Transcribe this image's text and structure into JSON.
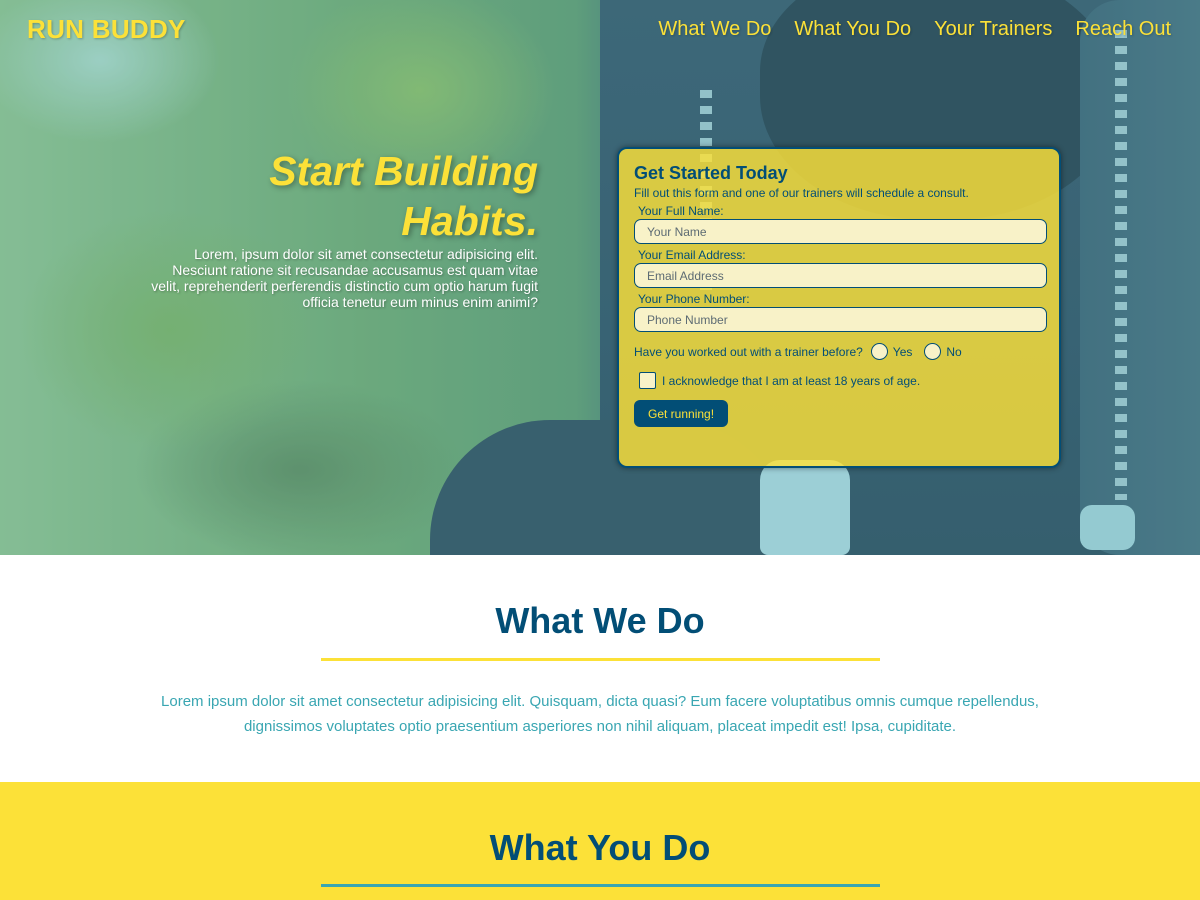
{
  "header": {
    "logo": "RUN BUDDY",
    "nav": [
      "What We Do",
      "What You Do",
      "Your Trainers",
      "Reach Out"
    ]
  },
  "hero": {
    "title": "Start Building Habits.",
    "text": "Lorem, ipsum dolor sit amet consectetur adipisicing elit. Nesciunt ratione sit recusandae accusamus est quam vitae velit, reprehenderit perferendis distinctio cum optio harum fugit officia tenetur eum minus enim animi?"
  },
  "signup": {
    "title": "Get Started Today",
    "subtitle": "Fill out this form and one of our trainers will schedule a consult.",
    "name_label": "Your Full Name:",
    "name_placeholder": "Your Name",
    "email_label": "Your Email Address:",
    "email_placeholder": "Email Address",
    "phone_label": "Your Phone Number:",
    "phone_placeholder": "Phone Number",
    "question": "Have you worked out with a trainer before?",
    "yes_label": "Yes",
    "no_label": "No",
    "acknowledge": "I acknowledge that I am at least 18 years of age.",
    "submit": "Get running!"
  },
  "what_we_do": {
    "title": "What We Do",
    "text": "Lorem ipsum dolor sit amet consectetur adipisicing elit. Quisquam, dicta quasi? Eum facere voluptatibus omnis cumque repellendus, dignissimos voluptates optio praesentium asperiores non nihil aliquam, placeat impedit est! Ipsa, cupiditate."
  },
  "what_you_do": {
    "title": "What You Do"
  },
  "colors": {
    "primary_yellow": "#fce138",
    "primary_blue": "#024e76",
    "accent_teal": "#39a6b2"
  }
}
